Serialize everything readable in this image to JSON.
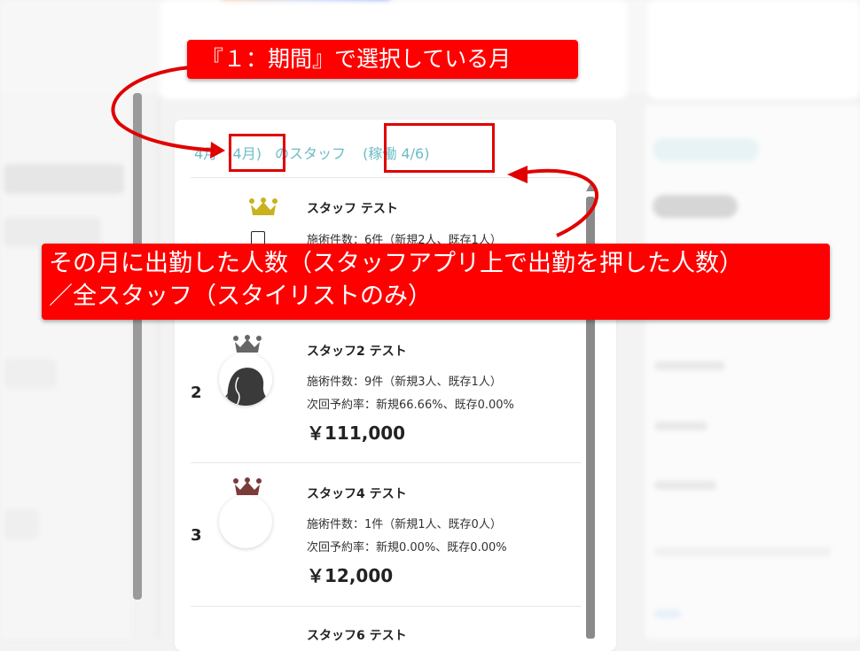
{
  "header": {
    "month_prefix": "4月",
    "month": "(4月)",
    "label": "のスタッフ",
    "active": "(稼働 4/6)"
  },
  "staff": [
    {
      "rank": "",
      "name": "スタッフ テスト",
      "treatment": "施術件数：6件（新規2人、既存1人）",
      "reservation_rate": "",
      "amount": "",
      "crown_color": "#c9b21e"
    },
    {
      "rank": "2",
      "name": "スタッフ2 テスト",
      "treatment": "施術件数：9件（新規3人、既存1人）",
      "reservation_rate": "次回予約率：新規66.66%、既存0.00%",
      "amount": "￥111,000",
      "crown_color": "#666666"
    },
    {
      "rank": "3",
      "name": "スタッフ4 テスト",
      "treatment": "施術件数：1件（新規1人、既存0人）",
      "reservation_rate": "次回予約率：新規0.00%、既存0.00%",
      "amount": "￥12,000",
      "crown_color": "#7a3b3b"
    },
    {
      "rank": "",
      "name": "スタッフ6 テスト",
      "treatment": "",
      "reservation_rate": "",
      "amount": "",
      "crown_color": ""
    }
  ],
  "annotations": {
    "top": "『１：期間』で選択している月",
    "bottom_line1": "その月に出勤した人数（スタッフアプリ上で出勤を押した人数）",
    "bottom_line2": "／全スタッフ（スタイリストのみ）"
  },
  "colors": {
    "accent_teal": "#6bbcc6",
    "annotation_red": "#ff0000"
  }
}
